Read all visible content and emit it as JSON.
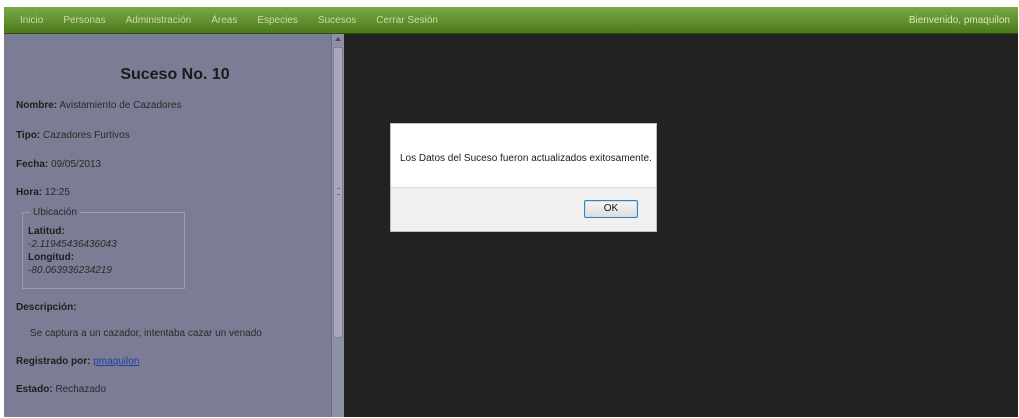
{
  "nav": {
    "items": [
      "Inicio",
      "Personas",
      "Administración",
      "Áreas",
      "Especies",
      "Sucesos",
      "Cerrar Sesión"
    ],
    "welcome": "Bienvenido, pmaquilon"
  },
  "suceso": {
    "title": "Suceso No. 10",
    "nombre_label": "Nombre:",
    "nombre": "Avistamiento de Cazadores",
    "tipo_label": "Tipo:",
    "tipo": "Cazadores Furtivos",
    "fecha_label": "Fecha:",
    "fecha": "09/05/2013",
    "hora_label": "Hora:",
    "hora": "12:25",
    "ubicacion": {
      "legend": "Ubicación",
      "latitud_label": "Latitud:",
      "latitud": "-2.11945436436043",
      "longitud_label": "Longitud:",
      "longitud": "-80.063936234219"
    },
    "descripcion_label": "Descripción:",
    "descripcion": "Se captura a un cazador, intentaba cazar un venado",
    "registrado_label": "Registrado por:",
    "registrado": "pmaquilon",
    "estado_label": "Estado:",
    "estado": "Rechazado"
  },
  "dialog": {
    "message": "Los Datos del Suceso fueron actualizados exitosamente.",
    "ok_label": "OK"
  },
  "colors": {
    "navbar": "#5e8c2a",
    "panel": "#7b7d95",
    "overlay": "#222222",
    "link": "#1f3fa6"
  }
}
